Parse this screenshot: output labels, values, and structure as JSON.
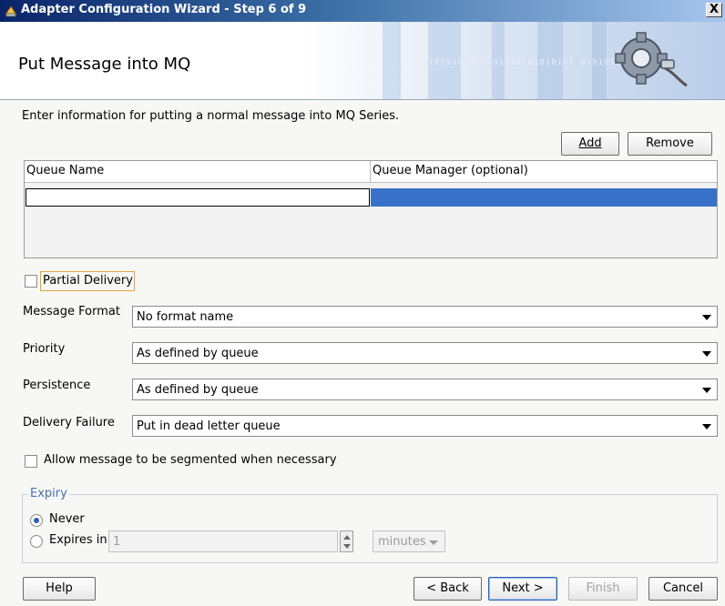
{
  "window": {
    "title": "Adapter Configuration Wizard - Step 6 of 9",
    "close_glyph": "X"
  },
  "header": {
    "title": "Put Message into MQ",
    "binary_text": "01010101010101010101010101 0101010101010"
  },
  "instructions": "Enter information for putting a normal message into MQ Series.",
  "table_buttons": {
    "add": "Add",
    "remove": "Remove"
  },
  "queue_table": {
    "columns": [
      "Queue Name",
      "Queue Manager (optional)"
    ],
    "rows": [
      {
        "queue_name": "",
        "queue_manager": ""
      }
    ]
  },
  "partial_delivery": {
    "label": "Partial Delivery",
    "checked": false
  },
  "fields": {
    "message_format": {
      "label": "Message Format",
      "value": "No format name"
    },
    "priority": {
      "label": "Priority",
      "value": "As defined by queue"
    },
    "persistence": {
      "label": "Persistence",
      "value": "As defined by queue"
    },
    "delivery_failure": {
      "label": "Delivery Failure",
      "value": "Put in dead letter queue"
    }
  },
  "segmentation": {
    "label": "Allow message to be segmented when necessary",
    "checked": false
  },
  "expiry": {
    "legend": "Expiry",
    "never_label": "Never",
    "expires_in_label": "Expires in",
    "selected": "never",
    "amount": "1",
    "unit": "minutes"
  },
  "footer": {
    "help": "Help",
    "back": "< Back",
    "next": "Next >",
    "finish": "Finish",
    "cancel": "Cancel"
  },
  "colors": {
    "titlebar_start": "#0a246a",
    "selection": "#3a71c8",
    "legend": "#4a6fb0",
    "focus": "#e8a33c"
  },
  "icons": [
    "app-icon",
    "gear-adapter-icon",
    "close-icon",
    "dropdown-arrow-icon",
    "spinner-icon"
  ]
}
